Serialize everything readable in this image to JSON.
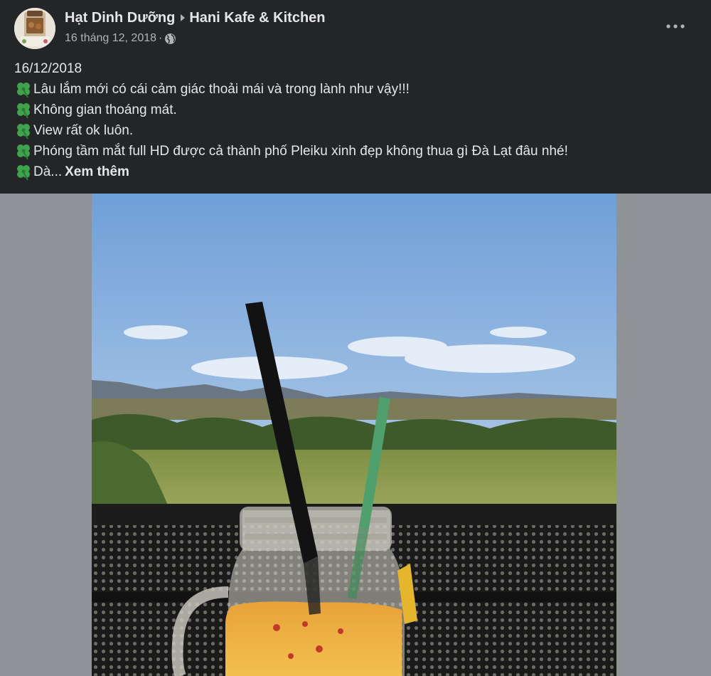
{
  "post": {
    "author": "Hạt Dinh Dưỡng",
    "destination": "Hani Kafe & Kitchen",
    "timestamp": "16 tháng 12, 2018",
    "separator": "·",
    "privacy_icon": "globe-icon",
    "menu_icon": "more-options-icon",
    "text_lines": [
      "16/12/2018",
      "Lâu lắm mới có cái cảm giác thoải mái và trong lành như vậy!!!",
      "Không gian thoáng mát.",
      "View rất ok luôn.",
      "Phóng tầm mắt full HD được cả thành phố Pleiku xinh đẹp không thua gì Đà Lạt đâu nhé!",
      "Dà..."
    ],
    "bullet_icon": "four-leaf-clover-icon",
    "see_more": "Xem thêm",
    "photo": {
      "subject": "iced drink in mason jar with black and green straws, overlooking green hills under blue sky"
    }
  },
  "colors": {
    "background": "#242526",
    "text_primary": "#e4e6eb",
    "text_secondary": "#b0b3b8",
    "photo_backdrop": "#8f9296",
    "clover_green": "#3fa34d"
  }
}
